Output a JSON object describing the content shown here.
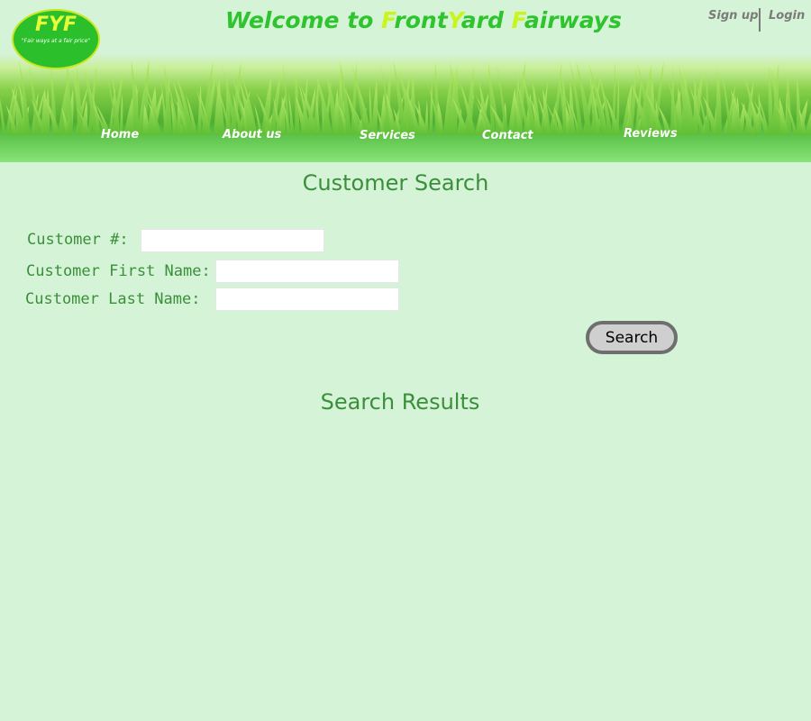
{
  "logo": {
    "title": "FYF",
    "tagline": "\"Fair ways at a fair price\""
  },
  "header": {
    "welcome_prefix": "Welcome to ",
    "brand_parts": [
      "F",
      "ront",
      "Y",
      "ard ",
      "F",
      "airways"
    ]
  },
  "auth": {
    "signup": "Sign up",
    "login": "Login"
  },
  "nav": {
    "items": [
      "Home",
      "About us",
      "Services",
      "Contact",
      "Reviews"
    ]
  },
  "search_section": {
    "title": "Customer Search",
    "fields": [
      {
        "label": "Customer #:",
        "value": ""
      },
      {
        "label": "Customer First Name:",
        "value": ""
      },
      {
        "label": "Customer Last Name:",
        "value": ""
      }
    ],
    "button": "Search"
  },
  "results": {
    "title": "Search Results"
  },
  "colors": {
    "background": "#d5f3d6",
    "heading_green": "#3b8f3b",
    "brand_green": "#2ec42e",
    "brand_highlight": "#c8f51d",
    "logo_fill": "#2bbf2b"
  }
}
